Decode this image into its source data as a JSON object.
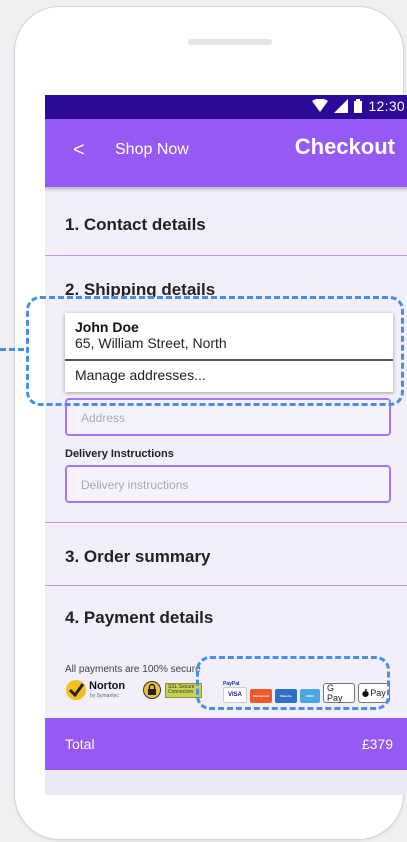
{
  "status": {
    "time": "12:30",
    "icons": [
      "wifi-icon",
      "signal-icon",
      "battery-icon"
    ]
  },
  "appbar": {
    "back": "<",
    "shop_now": "Shop Now",
    "title": "Checkout"
  },
  "sections": {
    "contact": "1. Contact details",
    "shipping": "2. Shipping details",
    "summary": "3. Order summary",
    "payment": "4. Payment details"
  },
  "shipping": {
    "address_placeholder": "Address",
    "delivery_label": "Delivery Instructions",
    "delivery_placeholder": "Delivery instructions"
  },
  "dropdown": {
    "name": "John Doe",
    "address": "65, William Street, North",
    "manage": "Manage addresses..."
  },
  "payment": {
    "secure_text": "All payments are 100% secure",
    "norton": "Norton",
    "norton_sub": "by Symantec",
    "ssl": "SSL Secure Connection",
    "paypal": "PayPal",
    "cards": [
      "VISA",
      "Mastercard",
      "Maestro",
      "AMEX"
    ],
    "gpay": "G Pay",
    "applepay": "Pay"
  },
  "total": {
    "label": "Total",
    "value": "£379"
  },
  "colors": {
    "accent": "#9659f4",
    "statusbar": "#2a0a96",
    "annotation": "#4a8fe6"
  }
}
